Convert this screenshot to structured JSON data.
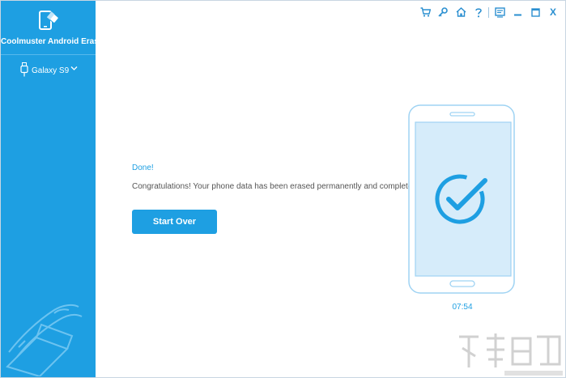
{
  "app": {
    "title": "Coolmuster Android Eraser"
  },
  "sidebar": {
    "device": "Galaxy S9"
  },
  "titlebar": {
    "close_label": "X",
    "icons": [
      "cart-icon",
      "key-icon",
      "home-icon",
      "help-icon",
      "feedback-icon",
      "minimize-icon",
      "maximize-icon",
      "close-icon"
    ]
  },
  "main": {
    "status_title": "Done!",
    "message": "Congratulations! Your phone data has been erased permanently and completely.",
    "start_over_label": "Start Over",
    "elapsed_time": "07:54"
  },
  "colors": {
    "accent": "#1e9fe2",
    "phone_screen": "#d6ecfa",
    "text": "#555555"
  }
}
